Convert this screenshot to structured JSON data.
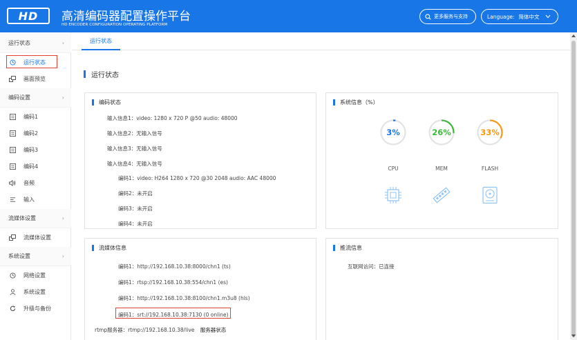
{
  "header": {
    "logo": "HD",
    "title": "高清编码器配置操作平台",
    "subtitle": "HD ENCODER CONFIGURATION OPERATING PLATFORM",
    "more_services": "更多服务与支持",
    "language_label": "Language:",
    "language_value": "简体中文",
    "accent": "#1976e6"
  },
  "sidebar": {
    "groups": [
      {
        "label": "运行状态"
      },
      {
        "label": "编码设置"
      },
      {
        "label": "流媒体设置"
      },
      {
        "label": "系统设置"
      }
    ],
    "items": [
      {
        "label": "运行状态",
        "icon": "clock-icon"
      },
      {
        "label": "画面预览",
        "icon": "preview-icon"
      },
      {
        "label": "编码1",
        "icon": "list-icon"
      },
      {
        "label": "编码2",
        "icon": "list-icon"
      },
      {
        "label": "编码3",
        "icon": "list-icon"
      },
      {
        "label": "编码4",
        "icon": "list-icon"
      },
      {
        "label": "音频",
        "icon": "speaker-icon"
      },
      {
        "label": "输入",
        "icon": "input-icon"
      },
      {
        "label": "流媒体设置",
        "icon": "preview-icon"
      },
      {
        "label": "网络设置",
        "icon": "clock-icon"
      },
      {
        "label": "系统设置",
        "icon": "user-icon"
      },
      {
        "label": "升级与备份",
        "icon": "refresh-icon"
      }
    ]
  },
  "tabs": [
    {
      "label": "运行状态"
    }
  ],
  "page_title": "运行状态",
  "encode_status": {
    "title": "编码状态",
    "lines": [
      "输入信息1：video: 1280 x 720 P @50 audio: 48000",
      "输入信息2：无输入信号",
      "输入信息3：无输入信号",
      "输入信息4：无输入信号",
      "编码1：video: H264 1280 x 720 @30 2048 audio: AAC 48000",
      "编码2：未开启",
      "编码3：未开启",
      "编码4：未开启"
    ]
  },
  "system_info": {
    "title": "系统信息（%）",
    "gauges": [
      {
        "label": "CPU",
        "value": "3%",
        "percent": 3,
        "color": "#1976e6",
        "icon": "cpu-icon"
      },
      {
        "label": "MEM",
        "value": "26%",
        "percent": 26,
        "color": "#3cb93c",
        "icon": "memory-icon"
      },
      {
        "label": "FLASH",
        "value": "33%",
        "percent": 33,
        "color": "#f59a12",
        "icon": "disk-icon"
      }
    ]
  },
  "stream_info": {
    "title": "流媒体信息",
    "lines": [
      "编码1：http://192.168.10.38:8000/chn1 (ts)",
      "编码1：rtsp://192.168.10.38:554/chn1 (es)",
      "编码1：http://192.168.10.38:8100/chn1.m3u8 (hls)",
      "编码1：srt://192.168.10.38:7130 (0 online)"
    ],
    "rtmp_label": "rtmp服务器：rtmp://192.168.10.38/live",
    "rtmp_status": "服务器状态"
  },
  "push_info": {
    "title": "推流信息",
    "line": "互联网访问：已连接"
  }
}
